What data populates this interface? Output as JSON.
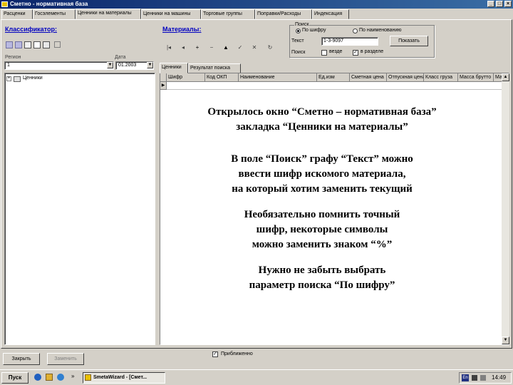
{
  "window": {
    "title": "Сметно - нормативная база",
    "buttons": [
      "_",
      "□",
      "×"
    ]
  },
  "tabs": [
    "Расценки",
    "Госэлементы",
    "Ценники на материалы",
    "Ценники на машины",
    "Торговые группы",
    "Поправки/Расходы",
    "Индексация"
  ],
  "left_panel": {
    "title": "Классификатор:",
    "region_label": "Регион",
    "region_value": "1",
    "date_label": "Дата",
    "date_value": "01.2003",
    "tree_item": "Ценники"
  },
  "materials": {
    "title": "Материалы:"
  },
  "search": {
    "group_label": "Поиск",
    "option_code": "По шифру",
    "option_name": "По наименованию",
    "text_label": "Текст",
    "text_value": "1-3-9097",
    "search_button": "Показать",
    "fields_label": "Поиск",
    "check_all": "везде",
    "check_section": "в разделе"
  },
  "grid_tabs": [
    "Ценники",
    "Результат поиска"
  ],
  "grid_columns": [
    "Шифр",
    "Код ОКП",
    "Наименование",
    "Ед.изм",
    "Сметная цена",
    "Отпускная цена",
    "Класс груза",
    "Масса брутто",
    "Мас"
  ],
  "overlay": {
    "p1": [
      "Открылось окно “Сметно – нормативная база”",
      "закладка “Ценники на материалы”"
    ],
    "p2": [
      "В поле “Поиск” графу “Текст” можно",
      "ввести шифр искомого материала,",
      "на который хотим заменить текущий"
    ],
    "p3": [
      "Необязательно помнить точный",
      "шифр, некоторые символы",
      "можно заменить знаком “%”"
    ],
    "p4": [
      "Нужно не забыть выбрать",
      "параметр поиска “По шифру”"
    ]
  },
  "bottom": {
    "close_button": "Закрыть",
    "replace_button": "Заменить",
    "checkbox_label": "Приближенно"
  },
  "taskbar": {
    "start": "Пуск",
    "task": "SmetaWizard - [Смет...",
    "clock": "14:49",
    "lang": "En"
  }
}
